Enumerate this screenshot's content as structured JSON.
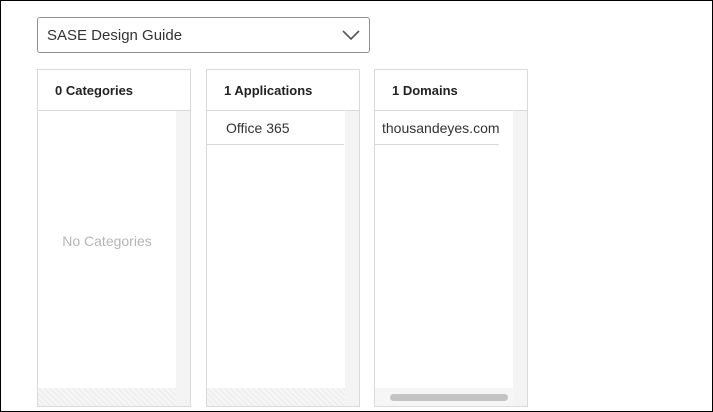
{
  "selector": {
    "selected": "SASE Design Guide"
  },
  "panels": {
    "categories": {
      "header": "0 Categories",
      "empty_text": "No Categories"
    },
    "applications": {
      "header": "1 Applications",
      "items": [
        "Office 365"
      ]
    },
    "domains": {
      "header": "1 Domains",
      "items": [
        "thousandeyes.com"
      ]
    }
  }
}
